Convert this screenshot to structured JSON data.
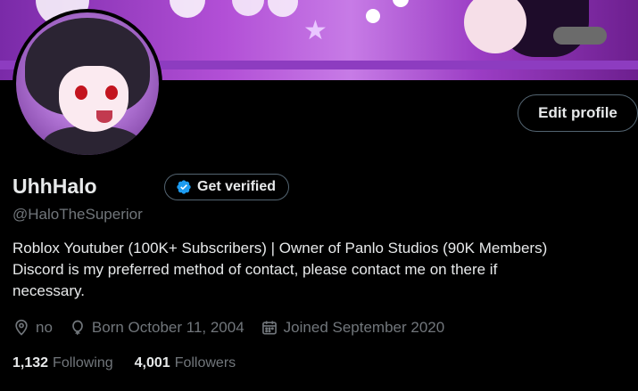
{
  "profile": {
    "display_name": "UhhHalo",
    "handle": "@HaloTheSuperior",
    "bio_lines": [
      "Roblox Youtuber (100K+ Subscribers) | Owner of Panlo Studios (90K Members)",
      "Discord is my preferred method of contact, please contact me on there if",
      "necessary."
    ],
    "location": "no",
    "birthday": "Born October 11, 2004",
    "joined": "Joined September 2020"
  },
  "buttons": {
    "edit_profile": "Edit profile",
    "get_verified": "Get verified"
  },
  "stats": {
    "following_count": "1,132",
    "following_label": "Following",
    "followers_count": "4,001",
    "followers_label": "Followers"
  },
  "icons": {
    "verified": "verified-badge-icon",
    "location": "location-pin-icon",
    "birthday": "balloon-icon",
    "joined": "calendar-icon"
  },
  "colors": {
    "background": "#000000",
    "text_primary": "#e7e9ea",
    "text_secondary": "#71767b",
    "border": "#536471",
    "verified_blue": "#1d9bf0",
    "banner_purple": "#b24fd6"
  }
}
